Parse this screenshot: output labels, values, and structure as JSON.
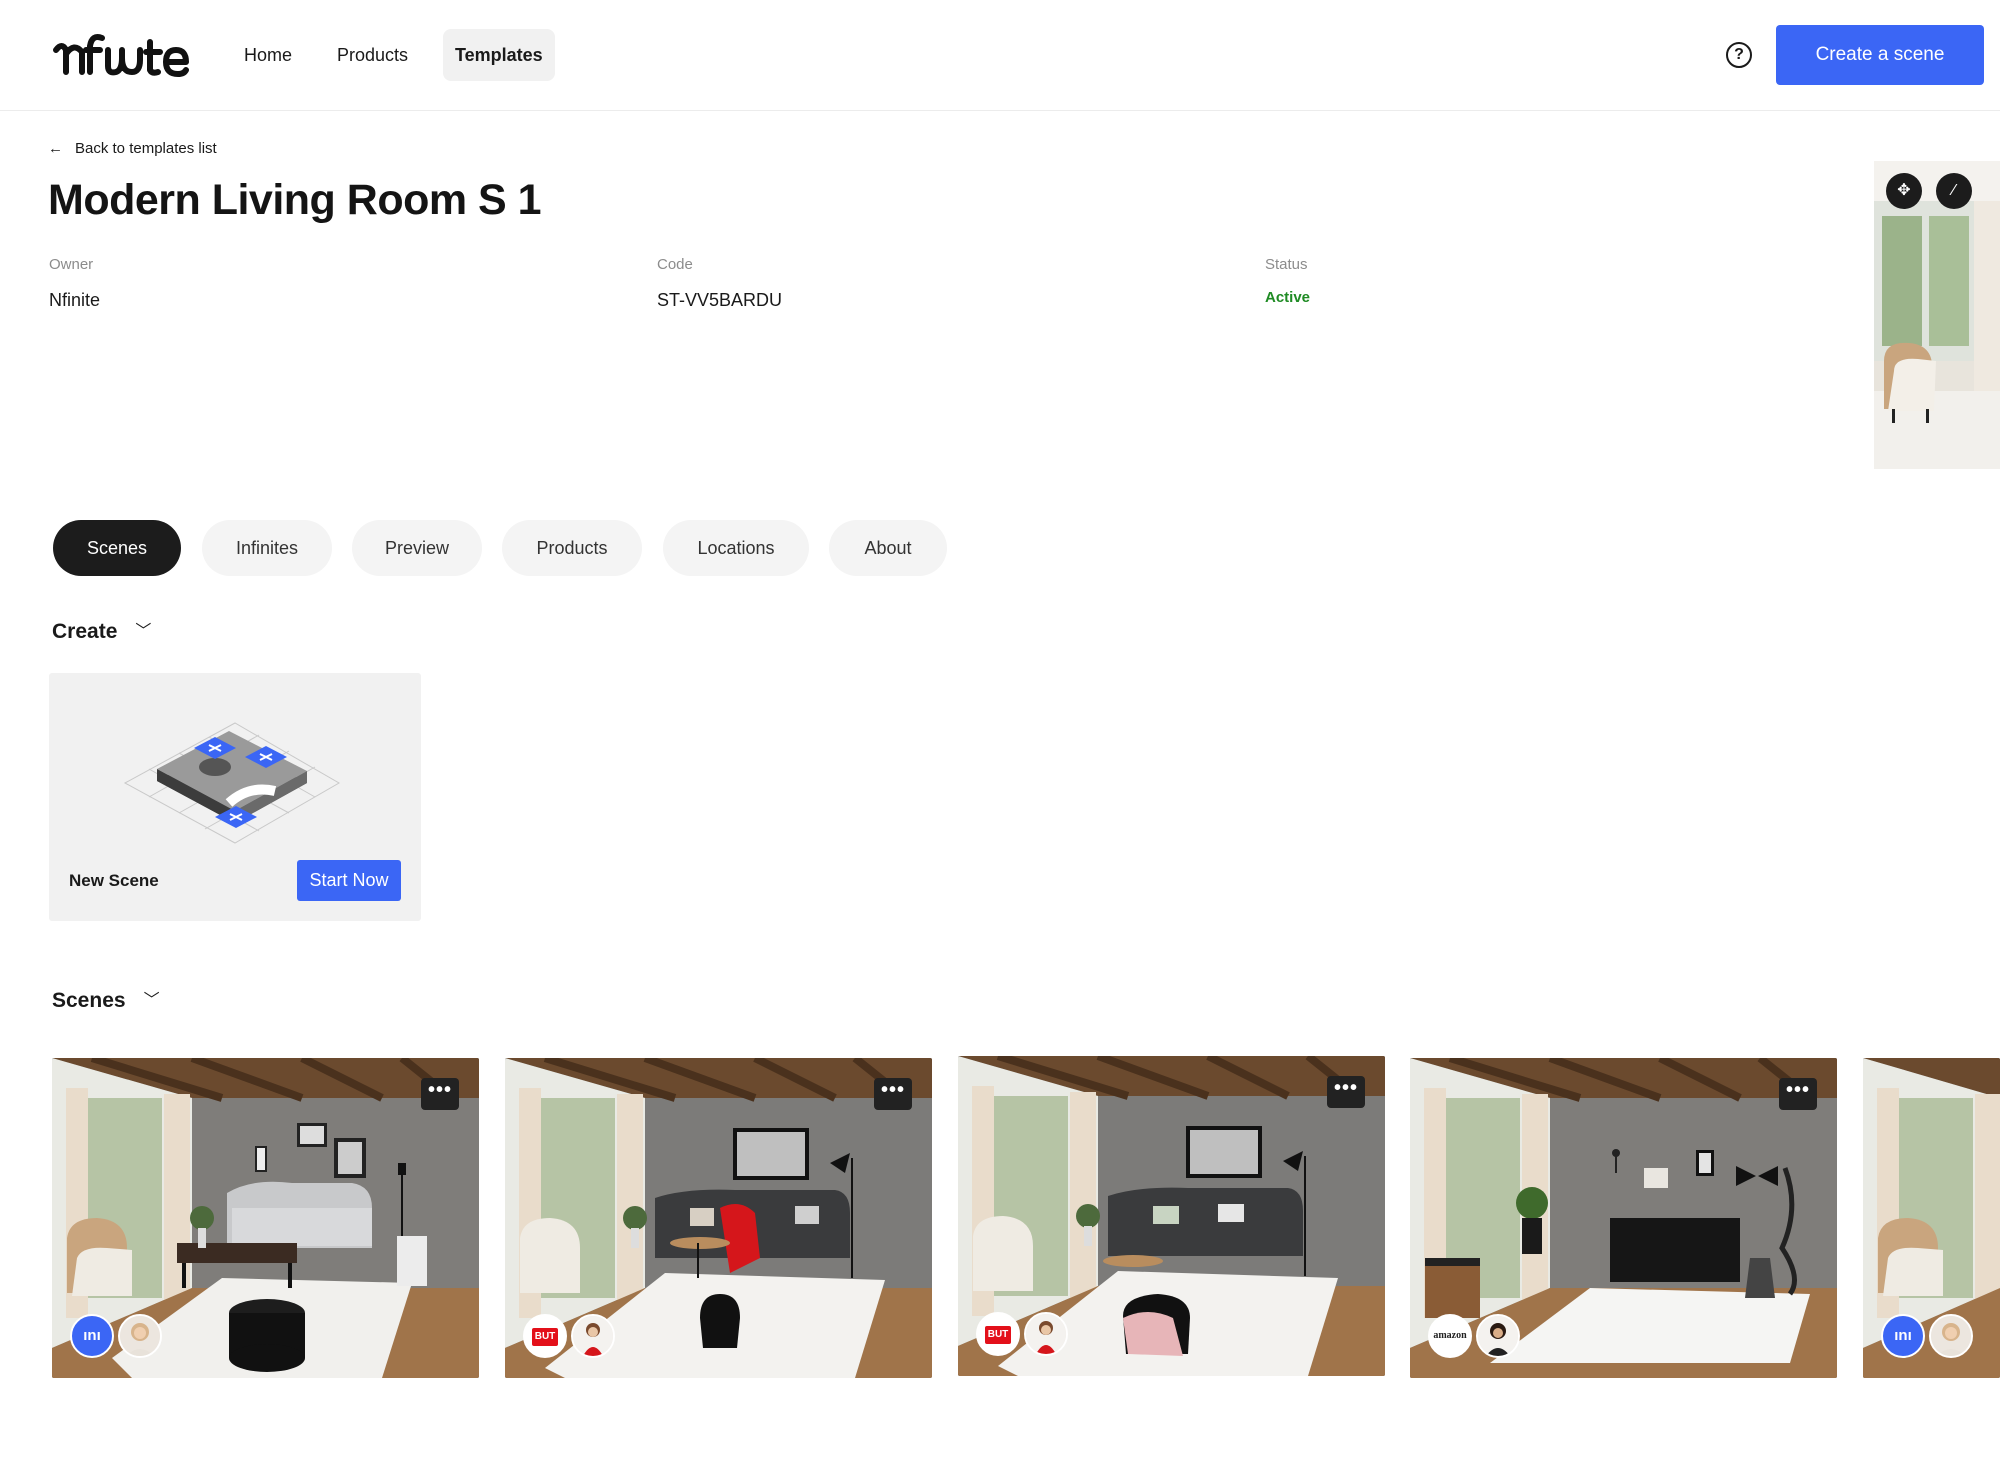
{
  "header": {
    "logo_text": "nfinite",
    "nav": [
      {
        "label": "Home",
        "active": false
      },
      {
        "label": "Products",
        "active": false
      },
      {
        "label": "Templates",
        "active": true
      }
    ],
    "help_icon": "question-circle-icon",
    "cta_label": "Create a scene",
    "accent_color": "#3b66f5"
  },
  "page": {
    "back_label": "Back to templates list",
    "title": "Modern Living Room S 1",
    "meta": {
      "owner_label": "Owner",
      "owner_value": "Nfinite",
      "code_label": "Code",
      "code_value": "ST-VV5BARDU",
      "status_label": "Status",
      "status_value": "Active",
      "status_color": "#1f8b24"
    }
  },
  "tabs": [
    {
      "label": "Scenes",
      "active": true
    },
    {
      "label": "Infinites",
      "active": false
    },
    {
      "label": "Preview",
      "active": false
    },
    {
      "label": "Products",
      "active": false
    },
    {
      "label": "Locations",
      "active": false
    },
    {
      "label": "About",
      "active": false
    }
  ],
  "create_section": {
    "heading": "Create",
    "card": {
      "label": "New Scene",
      "button_label": "Start Now"
    }
  },
  "scenes_section": {
    "heading": "Scenes",
    "more_label": "•••",
    "items": [
      {
        "brand": "nfinite",
        "brand_label": "ını",
        "variant": "grey-sofa"
      },
      {
        "brand": "but",
        "brand_label": "BUT",
        "variant": "dark-sofa-red-throw"
      },
      {
        "brand": "but",
        "brand_label": "BUT",
        "variant": "dark-sofa-pink-throw"
      },
      {
        "brand": "amazon",
        "brand_label": "amazon",
        "variant": "dresser"
      },
      {
        "brand": "nfinite",
        "brand_label": "ını",
        "variant": "partial"
      }
    ]
  }
}
